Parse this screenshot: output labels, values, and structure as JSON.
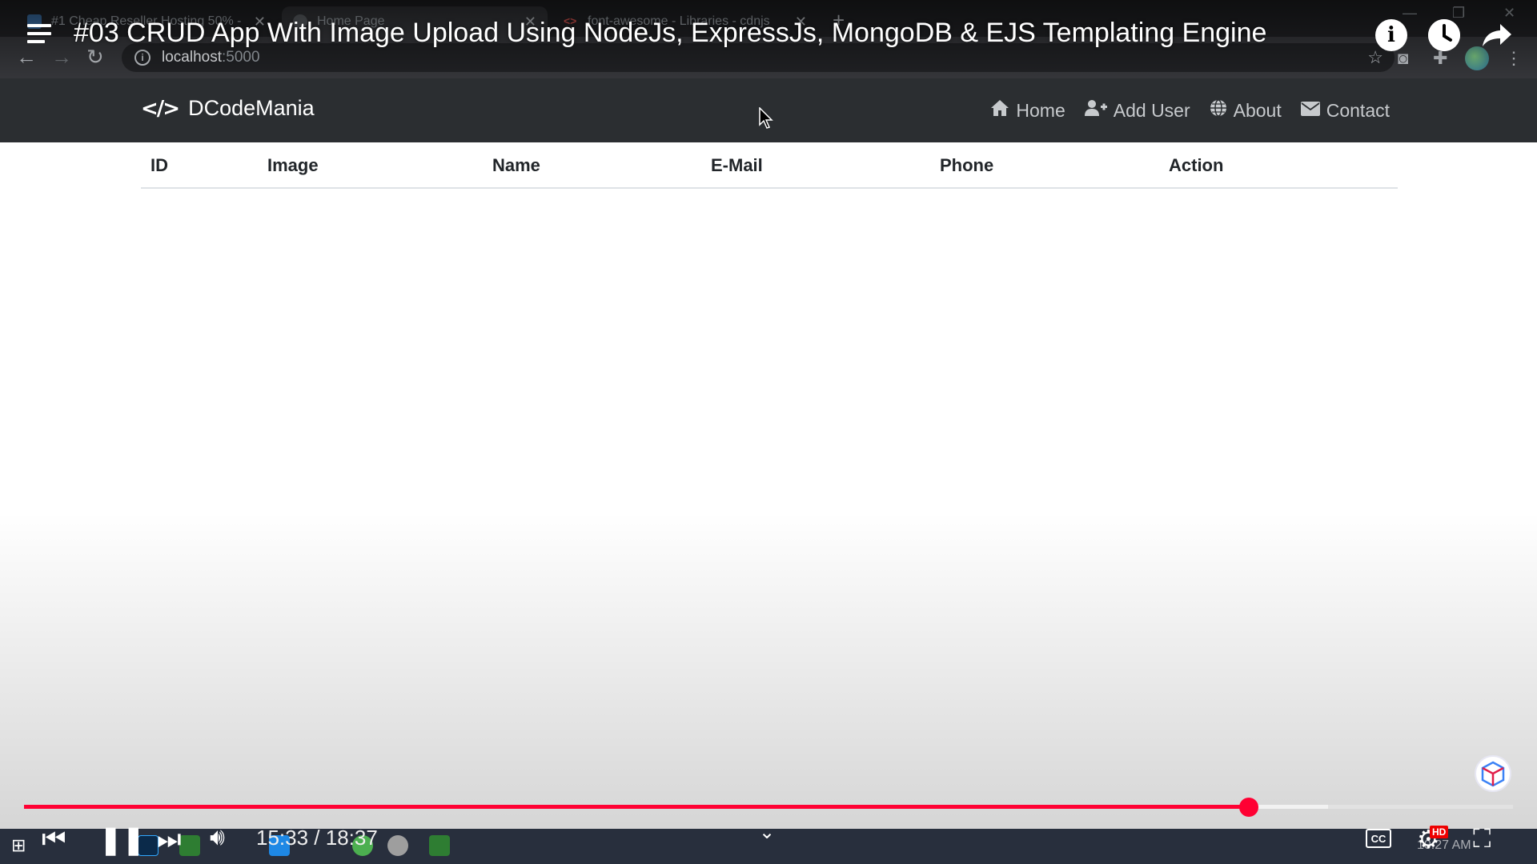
{
  "video": {
    "title": "#03 CRUD App With Image Upload Using NodeJs, ExpressJs, MongoDB & EJS Templating Engine",
    "current_time": "15:33",
    "duration": "18:37",
    "time_separator": " / ",
    "played_fraction": 0.8226,
    "buffered_fraction": 0.876,
    "hd_label": "HD",
    "cc_label": "CC"
  },
  "browser": {
    "tabs": [
      {
        "label": "#1 Cheap Reseller Hosting 50% -",
        "fav_color": "#3a6ea5"
      },
      {
        "label": "Home Page",
        "fav_color": "#5f6368"
      },
      {
        "label": "font-awesome - Libraries - cdnjs",
        "fav_color": "#d9534f"
      }
    ],
    "url_host": "localhost",
    "url_port": ":5000"
  },
  "site": {
    "brand": "DCodeMania",
    "nav": [
      {
        "label": "Home",
        "icon": "home-icon"
      },
      {
        "label": "Add User",
        "icon": "user-plus-icon"
      },
      {
        "label": "About",
        "icon": "globe-icon"
      },
      {
        "label": "Contact",
        "icon": "envelope-icon"
      }
    ]
  },
  "table": {
    "columns": [
      "ID",
      "Image",
      "Name",
      "E-Mail",
      "Phone",
      "Action"
    ],
    "rows": []
  },
  "taskbar": {
    "clock": "10:27 AM"
  },
  "colors": {
    "progress": "#ff0033",
    "navbar": "#2b2e31"
  }
}
